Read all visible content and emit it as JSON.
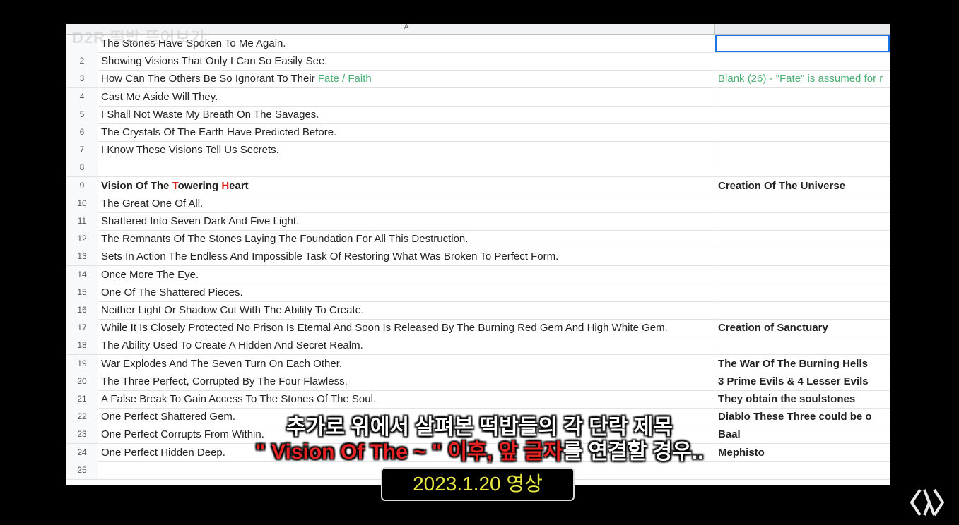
{
  "watermark": "D2R 떡밥 뜯어보기",
  "column_header": {
    "a": "A"
  },
  "rows": [
    {
      "num": "",
      "a": "The Stones Have Spoken To Me Again.",
      "b": "",
      "selected_b": true
    },
    {
      "num": "2",
      "a": "Showing Visions That Only I Can So Easily See.",
      "b": ""
    },
    {
      "num": "3",
      "a_pre": "How Can The Others Be So Ignorant To Their ",
      "a_green": "Fate / Faith",
      "b_green": "Blank (26) - \"Fate\" is assumed for r"
    },
    {
      "num": "4",
      "a": "Cast Me Aside Will They.",
      "b": ""
    },
    {
      "num": "5",
      "a": "I Shall Not Waste My Breath On The Savages.",
      "b": ""
    },
    {
      "num": "6",
      "a": "The Crystals Of The Earth Have Predicted Before.",
      "b": ""
    },
    {
      "num": "7",
      "a": "I Know These Visions Tell Us Secrets.",
      "b": ""
    },
    {
      "num": "8",
      "a": "",
      "b": ""
    },
    {
      "num": "9",
      "a_bold_parts": [
        "Vision Of The ",
        "T",
        "owering ",
        "H",
        "eart"
      ],
      "b_bold": "Creation Of The Universe"
    },
    {
      "num": "10",
      "a": "The Great One Of All.",
      "b": ""
    },
    {
      "num": "11",
      "a": "Shattered Into Seven Dark And Five Light.",
      "b": ""
    },
    {
      "num": "12",
      "a": "The Remnants Of The Stones Laying The Foundation For All This Destruction.",
      "b": ""
    },
    {
      "num": "13",
      "a": "Sets In Action The Endless And Impossible Task Of Restoring What Was Broken To Perfect Form.",
      "b": ""
    },
    {
      "num": "14",
      "a": "Once More The Eye.",
      "b": ""
    },
    {
      "num": "15",
      "a": "One Of The Shattered Pieces.",
      "b": ""
    },
    {
      "num": "16",
      "a": "Neither Light Or Shadow Cut With The Ability To Create.",
      "b": ""
    },
    {
      "num": "17",
      "a": "While It Is Closely Protected No Prison Is Eternal And Soon Is Released By The Burning Red Gem And High White Gem.",
      "b_bold": "Creation of Sanctuary"
    },
    {
      "num": "18",
      "a": "The Ability Used To Create A Hidden And Secret Realm.",
      "b": ""
    },
    {
      "num": "19",
      "a": "War Explodes And The Seven Turn On Each Other.",
      "b_bold": "The War Of The Burning Hells"
    },
    {
      "num": "20",
      "a": "The Three Perfect, Corrupted By The Four Flawless.",
      "b_bold": "3 Prime Evils & 4 Lesser Evils"
    },
    {
      "num": "21",
      "a": "A False Break To Gain Access To The Stones Of The Soul.",
      "b_bold": "They obtain the soulstones"
    },
    {
      "num": "22",
      "a": "One Perfect Shattered Gem.",
      "b_bold": "Diablo    These Three could be o"
    },
    {
      "num": "23",
      "a": "One Perfect Corrupts From Within.",
      "b_bold": "Baal"
    },
    {
      "num": "24",
      "a": "One Perfect Hidden Deep.",
      "b_bold": "Mephisto"
    },
    {
      "num": "25",
      "a": "",
      "b": ""
    }
  ],
  "subtitle": {
    "line1": "추가로 위에서 살펴본 떡밥들의 각 단락 제목",
    "line2_red": "\" Vision Of The ~ \" 이후, 앞 글자",
    "line2_rest": "를 연결할 경우.."
  },
  "date_label": "2023.1.20 영상",
  "colors": {
    "green": "#4caf72",
    "red": "#e02020",
    "date": "#e6e640"
  }
}
